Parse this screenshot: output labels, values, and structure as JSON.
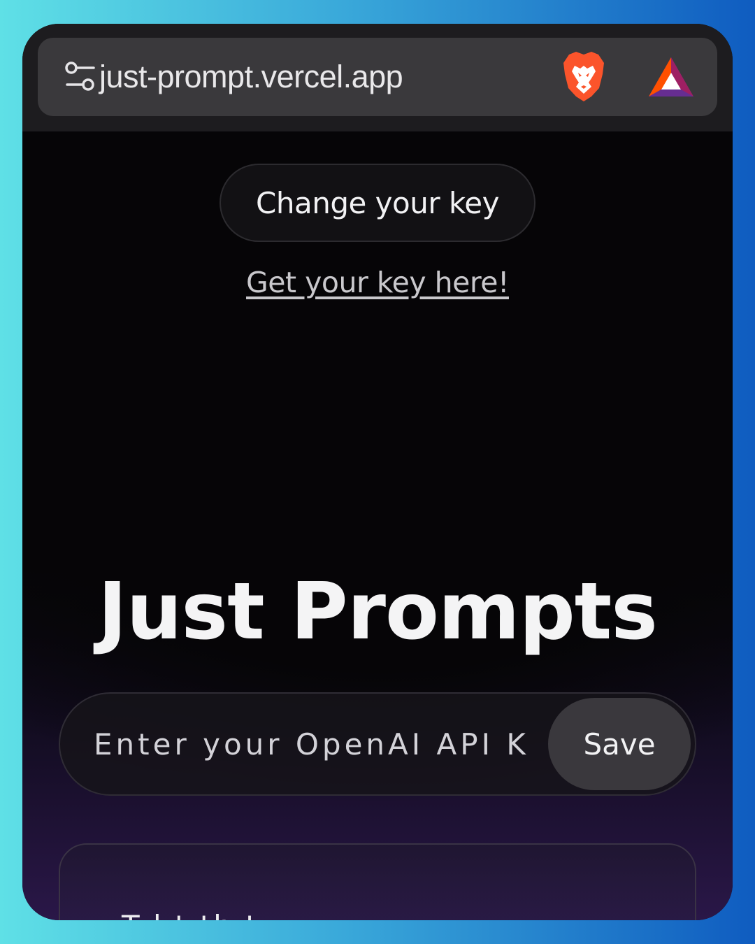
{
  "browser": {
    "url": "just-prompt.vercel.app",
    "icons": [
      "tune-icon",
      "brave-lion-icon",
      "bat-rewards-icon"
    ]
  },
  "header": {
    "change_key_label": "Change your key",
    "get_key_link": "Get your key here!"
  },
  "main": {
    "title": "Just Prompts",
    "api_key_input": {
      "placeholder": "Enter your OpenAI API K",
      "value": ""
    },
    "save_label": "Save",
    "card_text": "T l t th t"
  },
  "colors": {
    "background_gradient_left": "#5fe0e6",
    "background_gradient_right": "#0f5cc0",
    "page_bg": "#060507",
    "brave_orange": "#fb542b",
    "bat_purple": "#9e1f63"
  }
}
